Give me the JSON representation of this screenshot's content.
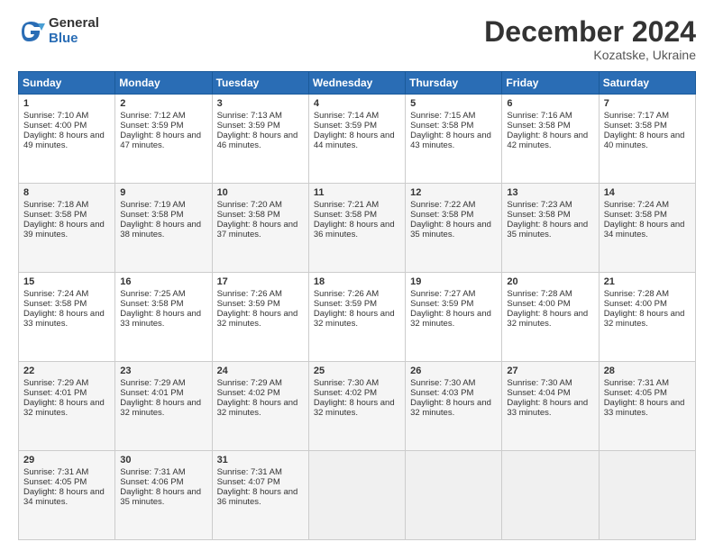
{
  "header": {
    "logo_general": "General",
    "logo_blue": "Blue",
    "month_title": "December 2024",
    "location": "Kozatske, Ukraine"
  },
  "weekdays": [
    "Sunday",
    "Monday",
    "Tuesday",
    "Wednesday",
    "Thursday",
    "Friday",
    "Saturday"
  ],
  "weeks": [
    [
      {
        "day": "1",
        "sunrise": "Sunrise: 7:10 AM",
        "sunset": "Sunset: 4:00 PM",
        "daylight": "Daylight: 8 hours and 49 minutes."
      },
      {
        "day": "2",
        "sunrise": "Sunrise: 7:12 AM",
        "sunset": "Sunset: 3:59 PM",
        "daylight": "Daylight: 8 hours and 47 minutes."
      },
      {
        "day": "3",
        "sunrise": "Sunrise: 7:13 AM",
        "sunset": "Sunset: 3:59 PM",
        "daylight": "Daylight: 8 hours and 46 minutes."
      },
      {
        "day": "4",
        "sunrise": "Sunrise: 7:14 AM",
        "sunset": "Sunset: 3:59 PM",
        "daylight": "Daylight: 8 hours and 44 minutes."
      },
      {
        "day": "5",
        "sunrise": "Sunrise: 7:15 AM",
        "sunset": "Sunset: 3:58 PM",
        "daylight": "Daylight: 8 hours and 43 minutes."
      },
      {
        "day": "6",
        "sunrise": "Sunrise: 7:16 AM",
        "sunset": "Sunset: 3:58 PM",
        "daylight": "Daylight: 8 hours and 42 minutes."
      },
      {
        "day": "7",
        "sunrise": "Sunrise: 7:17 AM",
        "sunset": "Sunset: 3:58 PM",
        "daylight": "Daylight: 8 hours and 40 minutes."
      }
    ],
    [
      {
        "day": "8",
        "sunrise": "Sunrise: 7:18 AM",
        "sunset": "Sunset: 3:58 PM",
        "daylight": "Daylight: 8 hours and 39 minutes."
      },
      {
        "day": "9",
        "sunrise": "Sunrise: 7:19 AM",
        "sunset": "Sunset: 3:58 PM",
        "daylight": "Daylight: 8 hours and 38 minutes."
      },
      {
        "day": "10",
        "sunrise": "Sunrise: 7:20 AM",
        "sunset": "Sunset: 3:58 PM",
        "daylight": "Daylight: 8 hours and 37 minutes."
      },
      {
        "day": "11",
        "sunrise": "Sunrise: 7:21 AM",
        "sunset": "Sunset: 3:58 PM",
        "daylight": "Daylight: 8 hours and 36 minutes."
      },
      {
        "day": "12",
        "sunrise": "Sunrise: 7:22 AM",
        "sunset": "Sunset: 3:58 PM",
        "daylight": "Daylight: 8 hours and 35 minutes."
      },
      {
        "day": "13",
        "sunrise": "Sunrise: 7:23 AM",
        "sunset": "Sunset: 3:58 PM",
        "daylight": "Daylight: 8 hours and 35 minutes."
      },
      {
        "day": "14",
        "sunrise": "Sunrise: 7:24 AM",
        "sunset": "Sunset: 3:58 PM",
        "daylight": "Daylight: 8 hours and 34 minutes."
      }
    ],
    [
      {
        "day": "15",
        "sunrise": "Sunrise: 7:24 AM",
        "sunset": "Sunset: 3:58 PM",
        "daylight": "Daylight: 8 hours and 33 minutes."
      },
      {
        "day": "16",
        "sunrise": "Sunrise: 7:25 AM",
        "sunset": "Sunset: 3:58 PM",
        "daylight": "Daylight: 8 hours and 33 minutes."
      },
      {
        "day": "17",
        "sunrise": "Sunrise: 7:26 AM",
        "sunset": "Sunset: 3:59 PM",
        "daylight": "Daylight: 8 hours and 32 minutes."
      },
      {
        "day": "18",
        "sunrise": "Sunrise: 7:26 AM",
        "sunset": "Sunset: 3:59 PM",
        "daylight": "Daylight: 8 hours and 32 minutes."
      },
      {
        "day": "19",
        "sunrise": "Sunrise: 7:27 AM",
        "sunset": "Sunset: 3:59 PM",
        "daylight": "Daylight: 8 hours and 32 minutes."
      },
      {
        "day": "20",
        "sunrise": "Sunrise: 7:28 AM",
        "sunset": "Sunset: 4:00 PM",
        "daylight": "Daylight: 8 hours and 32 minutes."
      },
      {
        "day": "21",
        "sunrise": "Sunrise: 7:28 AM",
        "sunset": "Sunset: 4:00 PM",
        "daylight": "Daylight: 8 hours and 32 minutes."
      }
    ],
    [
      {
        "day": "22",
        "sunrise": "Sunrise: 7:29 AM",
        "sunset": "Sunset: 4:01 PM",
        "daylight": "Daylight: 8 hours and 32 minutes."
      },
      {
        "day": "23",
        "sunrise": "Sunrise: 7:29 AM",
        "sunset": "Sunset: 4:01 PM",
        "daylight": "Daylight: 8 hours and 32 minutes."
      },
      {
        "day": "24",
        "sunrise": "Sunrise: 7:29 AM",
        "sunset": "Sunset: 4:02 PM",
        "daylight": "Daylight: 8 hours and 32 minutes."
      },
      {
        "day": "25",
        "sunrise": "Sunrise: 7:30 AM",
        "sunset": "Sunset: 4:02 PM",
        "daylight": "Daylight: 8 hours and 32 minutes."
      },
      {
        "day": "26",
        "sunrise": "Sunrise: 7:30 AM",
        "sunset": "Sunset: 4:03 PM",
        "daylight": "Daylight: 8 hours and 32 minutes."
      },
      {
        "day": "27",
        "sunrise": "Sunrise: 7:30 AM",
        "sunset": "Sunset: 4:04 PM",
        "daylight": "Daylight: 8 hours and 33 minutes."
      },
      {
        "day": "28",
        "sunrise": "Sunrise: 7:31 AM",
        "sunset": "Sunset: 4:05 PM",
        "daylight": "Daylight: 8 hours and 33 minutes."
      }
    ],
    [
      {
        "day": "29",
        "sunrise": "Sunrise: 7:31 AM",
        "sunset": "Sunset: 4:05 PM",
        "daylight": "Daylight: 8 hours and 34 minutes."
      },
      {
        "day": "30",
        "sunrise": "Sunrise: 7:31 AM",
        "sunset": "Sunset: 4:06 PM",
        "daylight": "Daylight: 8 hours and 35 minutes."
      },
      {
        "day": "31",
        "sunrise": "Sunrise: 7:31 AM",
        "sunset": "Sunset: 4:07 PM",
        "daylight": "Daylight: 8 hours and 36 minutes."
      },
      null,
      null,
      null,
      null
    ]
  ]
}
